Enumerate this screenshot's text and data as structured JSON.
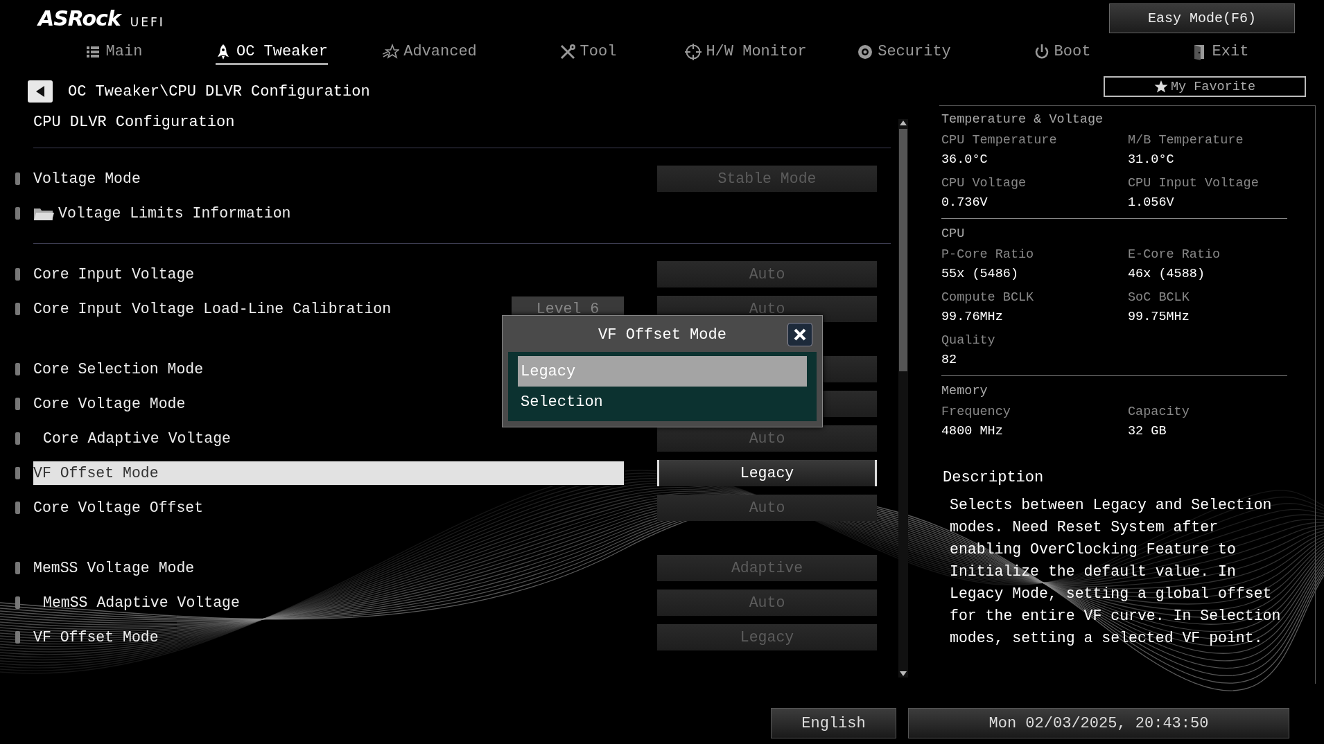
{
  "logo": {
    "brand": "ASRock",
    "suffix": "UEFI"
  },
  "easy_mode_button": "Easy Mode(F6)",
  "tabs": [
    {
      "label": "Main",
      "selected": false
    },
    {
      "label": "OC Tweaker",
      "selected": true
    },
    {
      "label": "Advanced",
      "selected": false
    },
    {
      "label": "Tool",
      "selected": false
    },
    {
      "label": "H/W Monitor",
      "selected": false
    },
    {
      "label": "Security",
      "selected": false
    },
    {
      "label": "Boot",
      "selected": false
    },
    {
      "label": "Exit",
      "selected": false
    }
  ],
  "breadcrumb": "OC Tweaker\\CPU DLVR Configuration",
  "page_title": "CPU DLVR Configuration",
  "favorite_button": "My Favorite",
  "groups": [
    {
      "divider_above": true,
      "rows": [
        {
          "kind": "setting",
          "label": "Voltage Mode",
          "value": "Stable Mode",
          "selected": false,
          "disabled": true
        },
        {
          "kind": "folder",
          "label": "Voltage Limits Information",
          "selected": false
        }
      ]
    },
    {
      "divider_above": true,
      "rows": [
        {
          "kind": "setting",
          "label": "Core Input Voltage",
          "value": "Auto",
          "selected": false,
          "disabled": true
        },
        {
          "kind": "setting",
          "label": "Core Input Voltage Load-Line Calibration",
          "extra": "Level 6",
          "value": "Auto",
          "selected": false,
          "disabled": true
        }
      ]
    },
    {
      "divider_above": false,
      "rows": [
        {
          "kind": "setting",
          "label": "Core Selection Mode",
          "selected": false,
          "disabled": true
        },
        {
          "kind": "setting",
          "label": "Core Voltage Mode",
          "selected": false,
          "disabled": true,
          "children": [
            {
              "kind": "setting",
              "label": "Core Adaptive Voltage",
              "value": "Auto",
              "selected": false,
              "disabled": true
            }
          ]
        },
        {
          "kind": "setting",
          "label": "VF Offset Mode",
          "value": "Legacy",
          "selected": true,
          "disabled": false
        },
        {
          "kind": "setting",
          "label": "Core Voltage Offset",
          "value": "Auto",
          "selected": false,
          "disabled": true
        }
      ]
    },
    {
      "divider_above": false,
      "rows": [
        {
          "kind": "setting",
          "label": "MemSS Voltage Mode",
          "value": "Adaptive",
          "selected": false,
          "disabled": true,
          "children": [
            {
              "kind": "setting",
              "label": "MemSS Adaptive Voltage",
              "value": "Auto",
              "selected": false,
              "disabled": true
            }
          ]
        },
        {
          "kind": "setting",
          "label": "VF Offset Mode",
          "value": "Legacy",
          "selected": false,
          "disabled": true
        }
      ]
    }
  ],
  "popup": {
    "title": "VF Offset Mode",
    "options": [
      {
        "label": "Legacy",
        "selected": true
      },
      {
        "label": "Selection",
        "selected": false
      }
    ]
  },
  "info_sections": [
    {
      "title": "Temperature & Voltage",
      "items": [
        {
          "label": "CPU Temperature",
          "value": "36.0°C"
        },
        {
          "label": "M/B Temperature",
          "value": "31.0°C"
        },
        {
          "label": "CPU Voltage",
          "value": "0.736V"
        },
        {
          "label": "CPU Input Voltage",
          "value": "1.056V"
        }
      ]
    },
    {
      "title": "CPU",
      "items": [
        {
          "label": "P-Core Ratio",
          "value": "55x (5486)"
        },
        {
          "label": "E-Core Ratio",
          "value": "46x (4588)"
        },
        {
          "label": "Compute BCLK",
          "value": "99.76MHz"
        },
        {
          "label": "SoC BCLK",
          "value": "99.75MHz"
        },
        {
          "label": "Quality",
          "value": "82"
        }
      ]
    },
    {
      "title": "Memory",
      "items": [
        {
          "label": "Frequency",
          "value": "4800 MHz"
        },
        {
          "label": "Capacity",
          "value": "32 GB"
        }
      ]
    }
  ],
  "description": {
    "title": "Description",
    "text": "Selects between Legacy and Selection modes. Need Reset System after enabling OverClocking Feature to Initialize the default value. In Legacy Mode, setting a global offset for the entire VF curve. In Selection modes, setting a selected VF point."
  },
  "footer": {
    "language": "English",
    "datetime": "Mon 02/03/2025, 20:43:50"
  }
}
